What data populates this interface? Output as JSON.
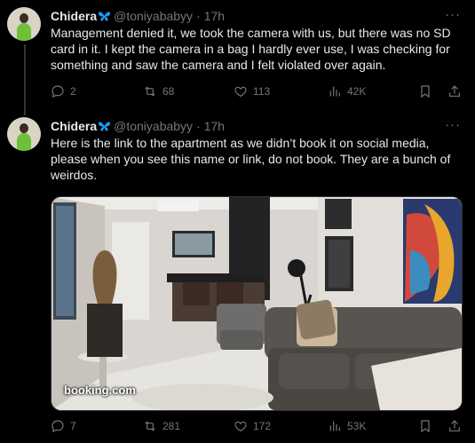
{
  "tweets": [
    {
      "author": {
        "name": "Chidera",
        "handle": "@toniyababyy",
        "time": "17h",
        "badge_icon": "butterfly-icon"
      },
      "text": "Management denied it, we took the camera with us, but there was no SD card in it. I kept the camera in a bag I hardly ever use, I was checking for something and saw the camera and I felt violated over again.",
      "stats": {
        "replies": "2",
        "reposts": "68",
        "likes": "113",
        "views": "42K"
      }
    },
    {
      "author": {
        "name": "Chidera",
        "handle": "@toniyababyy",
        "time": "17h",
        "badge_icon": "butterfly-icon"
      },
      "text": "Here is the link to the apartment as we didn’t book it on social media, please when you see this name or link, do not book. They are a bunch of weirdos.",
      "media": {
        "watermark": "booking.com",
        "description_icon": "apartment-photo"
      },
      "stats": {
        "replies": "7",
        "reposts": "281",
        "likes": "172",
        "views": "53K"
      }
    }
  ],
  "ui": {
    "dot": "·",
    "more_icon": "···",
    "accent": "#1d9bf0",
    "muted": "#71767b",
    "background": "#000000"
  }
}
